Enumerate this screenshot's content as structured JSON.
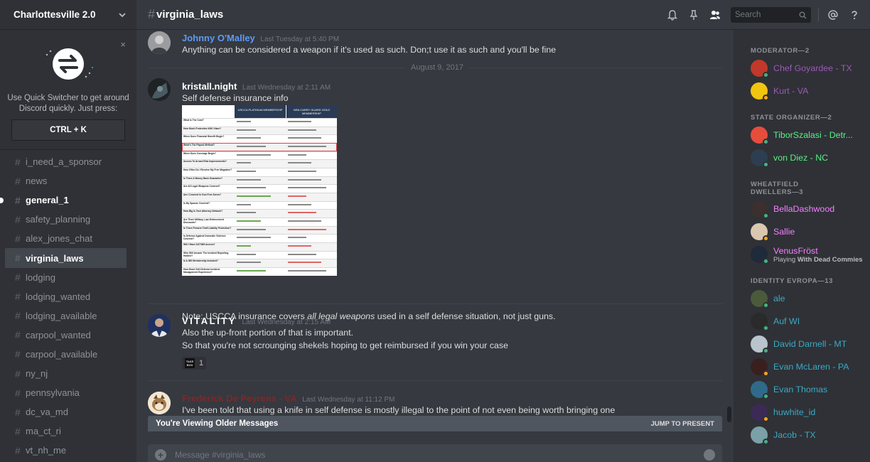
{
  "server": {
    "name": "Charlottesville 2.0"
  },
  "quick_switcher": {
    "text": "Use Quick Switcher to get around Discord quickly. Just press:",
    "shortcut": "CTRL + K",
    "close": "×"
  },
  "channels": [
    {
      "name": "i_need_a_sponsor",
      "state": "normal"
    },
    {
      "name": "news",
      "state": "normal"
    },
    {
      "name": "general_1",
      "state": "unread"
    },
    {
      "name": "safety_planning",
      "state": "normal"
    },
    {
      "name": "alex_jones_chat",
      "state": "normal"
    },
    {
      "name": "virginia_laws",
      "state": "active"
    },
    {
      "name": "lodging",
      "state": "normal"
    },
    {
      "name": "lodging_wanted",
      "state": "normal"
    },
    {
      "name": "lodging_available",
      "state": "normal"
    },
    {
      "name": "carpool_wanted",
      "state": "normal"
    },
    {
      "name": "carpool_available",
      "state": "normal"
    },
    {
      "name": "ny_nj",
      "state": "normal"
    },
    {
      "name": "pennsylvania",
      "state": "normal"
    },
    {
      "name": "dc_va_md",
      "state": "normal"
    },
    {
      "name": "ma_ct_ri",
      "state": "normal"
    },
    {
      "name": "vt_nh_me",
      "state": "normal"
    }
  ],
  "header": {
    "channel": "virginia_laws",
    "hash": "#",
    "search_placeholder": "Search"
  },
  "messages": {
    "m1": {
      "author": "Johnny O'Malley",
      "color": "#5b9bf5",
      "time": "Last Tuesday at 5:40 PM",
      "lines": [
        "Anything can be considered a weapon if it's used as such. Don;t use it as such and you'll be fine"
      ]
    },
    "date_divider": "August 9, 2017",
    "m2": {
      "author": "kristall.night",
      "color": "#ffffff",
      "time": "Last Wednesday at 2:11 AM",
      "line1": "Self defense insurance info",
      "note_pre": "Note: USCCA insurance covers ",
      "note_em": "all legal weapons",
      "note_post": " used in a self defense situation, not just guns."
    },
    "attachment": {
      "col_a": "USCCA PLATINUM MEMBERSHIP",
      "col_b": "NRA CARRY GUARD GOLD MEMBERSHIP",
      "rows": [
        "What is The Cost?",
        "How Much Protection Will I Have?",
        "When Does Financial Benefit Begin?",
        "What's The Payout Method?",
        "When Does Coverage Begin?",
        "Access To Armed Risk Improvements?",
        "How Often Do I Receive My Free Magazine?",
        "Is There A Money Back Guarantee?",
        "Are All Legal Weapons Covered?",
        "Am I Covered In Gun Free Zones?",
        "Is My Spouse Covered?",
        "How Big Is Your Attorney Network?",
        "Are There Military, Law Enforcement Discounts?",
        "Is There Firearm Theft Liability Protection?",
        "Is Defense Against Domestic Violence Covered?",
        "Will I Have 24/7/365 Access?",
        "Who Will Answer The Incident Reporting Hotline?",
        "Is A 365 Membership Included?",
        "How Much Self-Defense Incident Management Experience?"
      ]
    },
    "m3": {
      "author": "VITALITY",
      "color": "#ffffff",
      "time": "Last Wednesday at 2:15 AM",
      "lines": [
        "Also the up-front portion of that is important.",
        "So that you're not scrounging shekels hoping to get reimbursed if you win your case"
      ],
      "reaction_count": "1",
      "reaction_label": "TAKE BOX"
    },
    "m4": {
      "author": "Frederick De Peyrens - VA",
      "color": "#7a2a2a",
      "time": "Last Wednesday at 11:12 PM",
      "lines": [
        "I've been told that using a knife in self defense is mostly illegal to the point of not even being worth bringing one"
      ]
    }
  },
  "older_bar": {
    "text": "You're Viewing Older Messages",
    "jump": "JUMP TO PRESENT"
  },
  "composer": {
    "placeholder": "Message #virginia_laws"
  },
  "member_groups": [
    {
      "role": "MODERATOR—2",
      "members": [
        {
          "name": "Chef Goyardee - TX",
          "color": "#9b59b6",
          "status": "online"
        },
        {
          "name": "Kurt - VA",
          "color": "#9b59b6",
          "status": "idle"
        }
      ]
    },
    {
      "role": "STATE ORGANIZER—2",
      "members": [
        {
          "name": "TiborSzalasi - Detr...",
          "color": "#57f287",
          "status": "online"
        },
        {
          "name": "von Diez - NC",
          "color": "#57f287",
          "status": "online"
        }
      ]
    },
    {
      "role": "WHEATFIELD DWELLERS—3",
      "members": [
        {
          "name": "BellaDashwood",
          "color": "#f47fff",
          "status": "online"
        },
        {
          "name": "Sallie",
          "color": "#f47fff",
          "status": "idle"
        },
        {
          "name": "VenusFröst",
          "color": "#f47fff",
          "status": "online",
          "sub_pre": "Playing ",
          "sub_game": "With Dead Commies"
        }
      ]
    },
    {
      "role": "IDENTITY EVROPA—13",
      "members": [
        {
          "name": "ale",
          "color": "#3ba9c4",
          "status": "online"
        },
        {
          "name": "Auf WI",
          "color": "#3ba9c4",
          "status": "online"
        },
        {
          "name": "David Darnell - MT",
          "color": "#3ba9c4",
          "status": "online"
        },
        {
          "name": "Evan McLaren - PA",
          "color": "#3ba9c4",
          "status": "idle"
        },
        {
          "name": "Evan Thomas",
          "color": "#3ba9c4",
          "status": "online"
        },
        {
          "name": "huwhite_id",
          "color": "#3ba9c4",
          "status": "idle"
        },
        {
          "name": "Jacob - TX",
          "color": "#3ba9c4",
          "status": "online"
        }
      ]
    }
  ],
  "colors": {
    "online": "#43b581",
    "idle": "#faa61a"
  },
  "icons": [
    "chevron-down-icon",
    "close-icon",
    "bell-icon",
    "pin-icon",
    "members-icon",
    "search-icon",
    "mention-icon",
    "help-icon",
    "plus-icon",
    "emoji-icon"
  ]
}
